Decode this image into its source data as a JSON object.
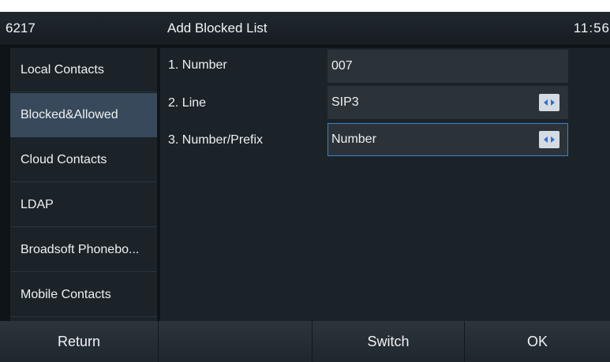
{
  "status_bar": {
    "extension": "6217",
    "title": "Add Blocked List",
    "time": "11:56"
  },
  "sidebar": {
    "items": [
      {
        "label": "Local Contacts"
      },
      {
        "label": "Blocked&Allowed"
      },
      {
        "label": "Cloud Contacts"
      },
      {
        "label": "LDAP"
      },
      {
        "label": "Broadsoft Phonebo..."
      },
      {
        "label": "Mobile Contacts"
      }
    ],
    "active_index": 1
  },
  "form": {
    "number": {
      "label": "1. Number",
      "value": "007"
    },
    "line": {
      "label": "2. Line",
      "value": "SIP3"
    },
    "number_prefix": {
      "label": "3. Number/Prefix",
      "value": "Number"
    }
  },
  "softkeys": [
    "Return",
    "",
    "Switch",
    "OK"
  ],
  "colors": {
    "accent": "#3f7fc8",
    "active_item": "#37495a",
    "background": "#0f1418"
  }
}
